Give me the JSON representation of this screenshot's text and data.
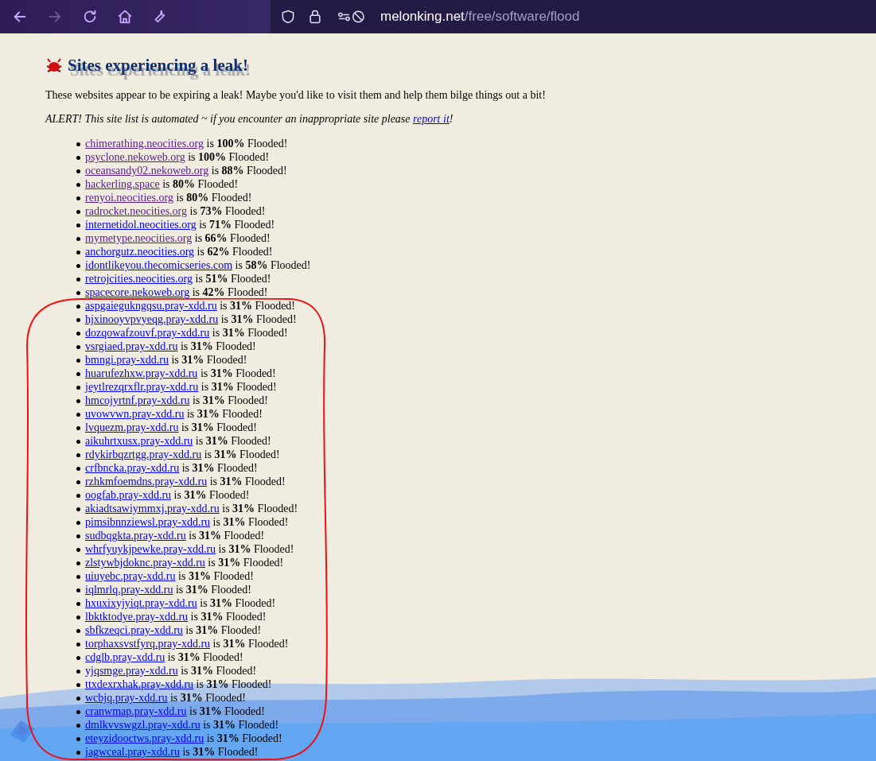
{
  "toolbar": {
    "buttons": [
      {
        "kind": "back",
        "disabled": false
      },
      {
        "kind": "forward",
        "disabled": true
      },
      {
        "kind": "reload",
        "disabled": false
      },
      {
        "kind": "home",
        "disabled": false
      },
      {
        "kind": "tools",
        "disabled": false
      }
    ],
    "address": {
      "host": "melonking.net",
      "path": "/free/software/flood"
    }
  },
  "heading": "Sites experiencing a leak!",
  "description": "These websites appear to be expiring a leak! Maybe you'd like to visit them and help them bilge things out a bit!",
  "alert": {
    "before": "ALERT! This site list is automated ~ if you encounter an inappropriate site please ",
    "link": "report it",
    "after": "!"
  },
  "sites": [
    {
      "link": "chimerathing.neocities.org",
      "text": "is **100%** Flooded!",
      "visited": true
    },
    {
      "link": "psyclone.nekoweb.org",
      "text": "is **100%** Flooded!",
      "visited": true
    },
    {
      "link": "oceansandy02.nekoweb.org",
      "text": "is **88%** Flooded!",
      "visited": true
    },
    {
      "link": "hackerling.space",
      "text": "is **80%** Flooded!",
      "visited": true
    },
    {
      "link": "renyoi.neocities.org",
      "text": "is **80%** Flooded!",
      "visited": true
    },
    {
      "link": "radrocket.neocities.org",
      "text": "is **73%** Flooded!",
      "visited": true
    },
    {
      "link": "internetidol.neocities.org",
      "text": "is **71%** Flooded!",
      "visited": false
    },
    {
      "link": "mymetype.neocities.org",
      "text": "is **66%** Flooded!",
      "visited": true
    },
    {
      "link": "anchorgutz.neocities.org",
      "text": "is **62%** Flooded!",
      "visited": false
    },
    {
      "link": "idontlikeyou.thecomicseries.com",
      "text": "is **58%** Flooded!",
      "visited": false
    },
    {
      "link": "retrojcities.neocities.org",
      "text": "is **51%** Flooded!",
      "visited": false
    },
    {
      "link": "spacecore.nekoweb.org",
      "text": "is **42%** Flooded!",
      "visited": false
    },
    {
      "link": "aspgaiegukngqsu.pray-xdd.ru",
      "text": "is **31%** Flooded!",
      "visited": false
    },
    {
      "link": "hjxinooyvpvyeqg.pray-xdd.ru",
      "text": "is **31%** Flooded!",
      "visited": false
    },
    {
      "link": "dozqowafzouvf.pray-xdd.ru",
      "text": "is **31%** Flooded!",
      "visited": false
    },
    {
      "link": "vsrgiaed.pray-xdd.ru",
      "text": "is **31%** Flooded!",
      "visited": false
    },
    {
      "link": "bmngi.pray-xdd.ru",
      "text": "is **31%** Flooded!",
      "visited": false
    },
    {
      "link": "huarufezhxw.pray-xdd.ru",
      "text": "is **31%** Flooded!",
      "visited": false
    },
    {
      "link": "jeytlrezqrxflr.pray-xdd.ru",
      "text": "is **31%** Flooded!",
      "visited": false
    },
    {
      "link": "hmcojyrtnf.pray-xdd.ru",
      "text": "is **31%** Flooded!",
      "visited": false
    },
    {
      "link": "uvowvwn.pray-xdd.ru",
      "text": "is **31%** Flooded!",
      "visited": false
    },
    {
      "link": "lvquezm.pray-xdd.ru",
      "text": "is **31%** Flooded!",
      "visited": false
    },
    {
      "link": "aikuhrtxusx.pray-xdd.ru",
      "text": "is **31%** Flooded!",
      "visited": false
    },
    {
      "link": "rdykirbqzrtgg.pray-xdd.ru",
      "text": "is **31%** Flooded!",
      "visited": false
    },
    {
      "link": "crfbncka.pray-xdd.ru",
      "text": "is **31%** Flooded!",
      "visited": false
    },
    {
      "link": "rzhkmfoemdns.pray-xdd.ru",
      "text": "is **31%** Flooded!",
      "visited": false
    },
    {
      "link": "oogfab.pray-xdd.ru",
      "text": "is **31%** Flooded!",
      "visited": false
    },
    {
      "link": "akiadtsawiymmxj.pray-xdd.ru",
      "text": "is **31%** Flooded!",
      "visited": false
    },
    {
      "link": "pimsibnnziewsl.pray-xdd.ru",
      "text": "is **31%** Flooded!",
      "visited": false
    },
    {
      "link": "sudbqgkta.pray-xdd.ru",
      "text": "is **31%** Flooded!",
      "visited": false
    },
    {
      "link": "whrfyuykjpewke.pray-xdd.ru",
      "text": "is **31%** Flooded!",
      "visited": false
    },
    {
      "link": "zlstywbjdoknc.pray-xdd.ru",
      "text": "is **31%** Flooded!",
      "visited": false
    },
    {
      "link": "uiuyebc.pray-xdd.ru",
      "text": "is **31%** Flooded!",
      "visited": false
    },
    {
      "link": "iqlmrlq.pray-xdd.ru",
      "text": "is **31%** Flooded!",
      "visited": false
    },
    {
      "link": "hxuxixyjyiqt.pray-xdd.ru",
      "text": "is **31%** Flooded!",
      "visited": false
    },
    {
      "link": "lbktktodye.pray-xdd.ru",
      "text": "is **31%** Flooded!",
      "visited": false
    },
    {
      "link": "sbfkzeqci.pray-xdd.ru",
      "text": "is **31%** Flooded!",
      "visited": false
    },
    {
      "link": "torphaxsvstfyrq.pray-xdd.ru",
      "text": "is **31%** Flooded!",
      "visited": false
    },
    {
      "link": "cdglb.pray-xdd.ru",
      "text": "is **31%** Flooded!",
      "visited": false
    },
    {
      "link": "yjqsmge.pray-xdd.ru",
      "text": "is **31%** Flooded!",
      "visited": false
    },
    {
      "link": "ttxdexrxhak.pray-xdd.ru",
      "text": "is **31%** Flooded!",
      "visited": false
    },
    {
      "link": "wcbjq.pray-xdd.ru",
      "text": "is **31%** Flooded!",
      "visited": false
    },
    {
      "link": "cranwmap.pray-xdd.ru",
      "text": "is **31%** Flooded!",
      "visited": false
    },
    {
      "link": "dmlkvvswgzl.pray-xdd.ru",
      "text": "is **31%** Flooded!",
      "visited": false
    },
    {
      "link": "eteyzidooctws.pray-xdd.ru",
      "text": "is **31%** Flooded!",
      "visited": false
    },
    {
      "link": "jagwceal.pray-xdd.ru",
      "text": "is **31%** Flooded!",
      "visited": false
    }
  ]
}
